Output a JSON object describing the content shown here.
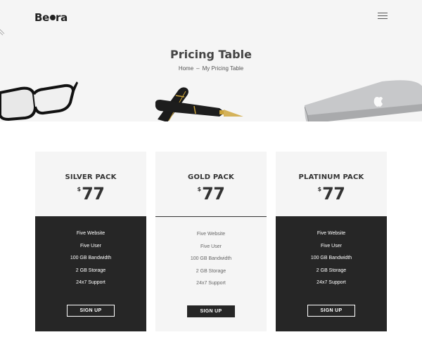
{
  "header": {
    "logo_text": "Be",
    "logo_suffix": "ra"
  },
  "hero": {
    "title": "Pricing Table",
    "breadcrumb": {
      "home": "Home",
      "separator": "–",
      "current": "My Pricing Table"
    }
  },
  "plans": [
    {
      "name": "SILVER PACK",
      "currency": "$",
      "price": "77",
      "features": [
        "Five Website",
        "Five User",
        "100 GB Bandwidth",
        "2 GB Storage",
        "24x7 Support"
      ],
      "button": "SIGN UP"
    },
    {
      "name": "GOLD PACK",
      "currency": "$",
      "price": "77",
      "features": [
        "Five Website",
        "Five User",
        "100 GB Bandwidth",
        "2 GB Storage",
        "24x7 Support"
      ],
      "button": "SIGN UP"
    },
    {
      "name": "PLATINUM PACK",
      "currency": "$",
      "price": "77",
      "features": [
        "Five Website",
        "Five User",
        "100 GB Bandwidth",
        "2 GB Storage",
        "24x7 Support"
      ],
      "button": "SIGN UP"
    }
  ],
  "colors": {
    "dark": "#262626",
    "light_bg": "#f5f5f5",
    "text": "#333333"
  }
}
